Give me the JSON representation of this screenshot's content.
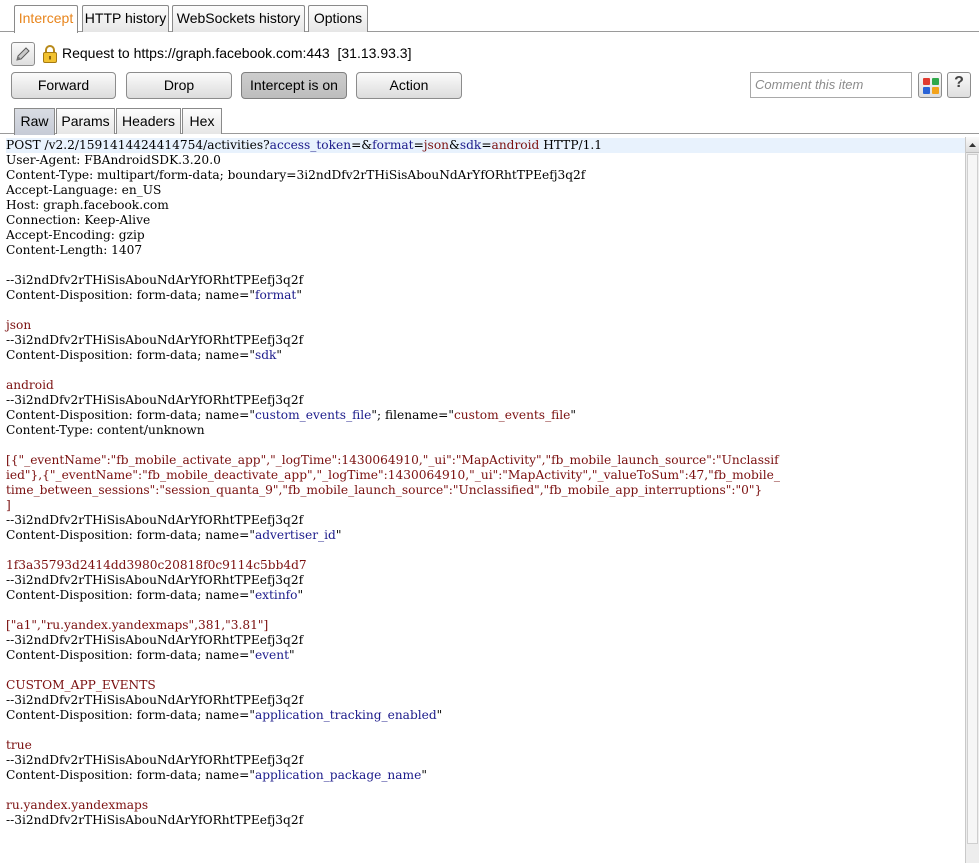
{
  "tabs": [
    "Intercept",
    "HTTP history",
    "WebSockets history",
    "Options"
  ],
  "request_info": "Request to https://graph.facebook.com:443  [31.13.93.3]",
  "buttons": {
    "forward": "Forward",
    "drop": "Drop",
    "intercept": "Intercept is on",
    "action": "Action"
  },
  "comment_placeholder": "Comment this item",
  "help_label": "?",
  "icons": {
    "edit": "pencil-icon",
    "lock": "lock-icon",
    "highlight": "color-grid-icon",
    "help": "help-icon"
  },
  "colors": {
    "active_tab": "#e8851c",
    "param_name": "#1b1a8a",
    "param_value": "#7a0f0f"
  },
  "subtabs": [
    "Raw",
    "Params",
    "Headers",
    "Hex"
  ],
  "request_lines": [
    "POST /v2.2/1591414424414754/activities?access_token=&format=json&sdk=android HTTP/1.1",
    "User-Agent: FBAndroidSDK.3.20.0",
    "Content-Type: multipart/form-data; boundary=3i2ndDfv2rTHiSisAbouNdArYfORhtTPEefj3q2f",
    "Accept-Language: en_US",
    "Host: graph.facebook.com",
    "Connection: Keep-Alive",
    "Accept-Encoding: gzip",
    "Content-Length: 1407",
    "",
    "--3i2ndDfv2rTHiSisAbouNdArYfORhtTPEefj3q2f",
    "Content-Disposition: form-data; name=\"format\"",
    "",
    "json",
    "--3i2ndDfv2rTHiSisAbouNdArYfORhtTPEefj3q2f",
    "Content-Disposition: form-data; name=\"sdk\"",
    "",
    "android",
    "--3i2ndDfv2rTHiSisAbouNdArYfORhtTPEefj3q2f",
    "Content-Disposition: form-data; name=\"custom_events_file\"; filename=\"custom_events_file\"",
    "Content-Type: content/unknown",
    "",
    "[{\"_eventName\":\"fb_mobile_activate_app\",\"_logTime\":1430064910,\"_ui\":\"MapActivity\",\"fb_mobile_launch_source\":\"Unclassif",
    "ied\"},{\"_eventName\":\"fb_mobile_deactivate_app\",\"_logTime\":1430064910,\"_ui\":\"MapActivity\",\"_valueToSum\":47,\"fb_mobile_",
    "time_between_sessions\":\"session_quanta_9\",\"fb_mobile_launch_source\":\"Unclassified\",\"fb_mobile_app_interruptions\":\"0\"}",
    "]",
    "--3i2ndDfv2rTHiSisAbouNdArYfORhtTPEefj3q2f",
    "Content-Disposition: form-data; name=\"advertiser_id\"",
    "",
    "1f3a35793d2414dd3980c20818f0c9114c5bb4d7",
    "--3i2ndDfv2rTHiSisAbouNdArYfORhtTPEefj3q2f",
    "Content-Disposition: form-data; name=\"extinfo\"",
    "",
    "[\"a1\",\"ru.yandex.yandexmaps\",381,\"3.81\"]",
    "--3i2ndDfv2rTHiSisAbouNdArYfORhtTPEefj3q2f",
    "Content-Disposition: form-data; name=\"event\"",
    "",
    "CUSTOM_APP_EVENTS",
    "--3i2ndDfv2rTHiSisAbouNdArYfORhtTPEefj3q2f",
    "Content-Disposition: form-data; name=\"application_tracking_enabled\"",
    "",
    "true",
    "--3i2ndDfv2rTHiSisAbouNdArYfORhtTPEefj3q2f",
    "Content-Disposition: form-data; name=\"application_package_name\"",
    "",
    "ru.yandex.yandexmaps",
    "--3i2ndDfv2rTHiSisAbouNdArYfORhtTPEefj3q2f"
  ]
}
